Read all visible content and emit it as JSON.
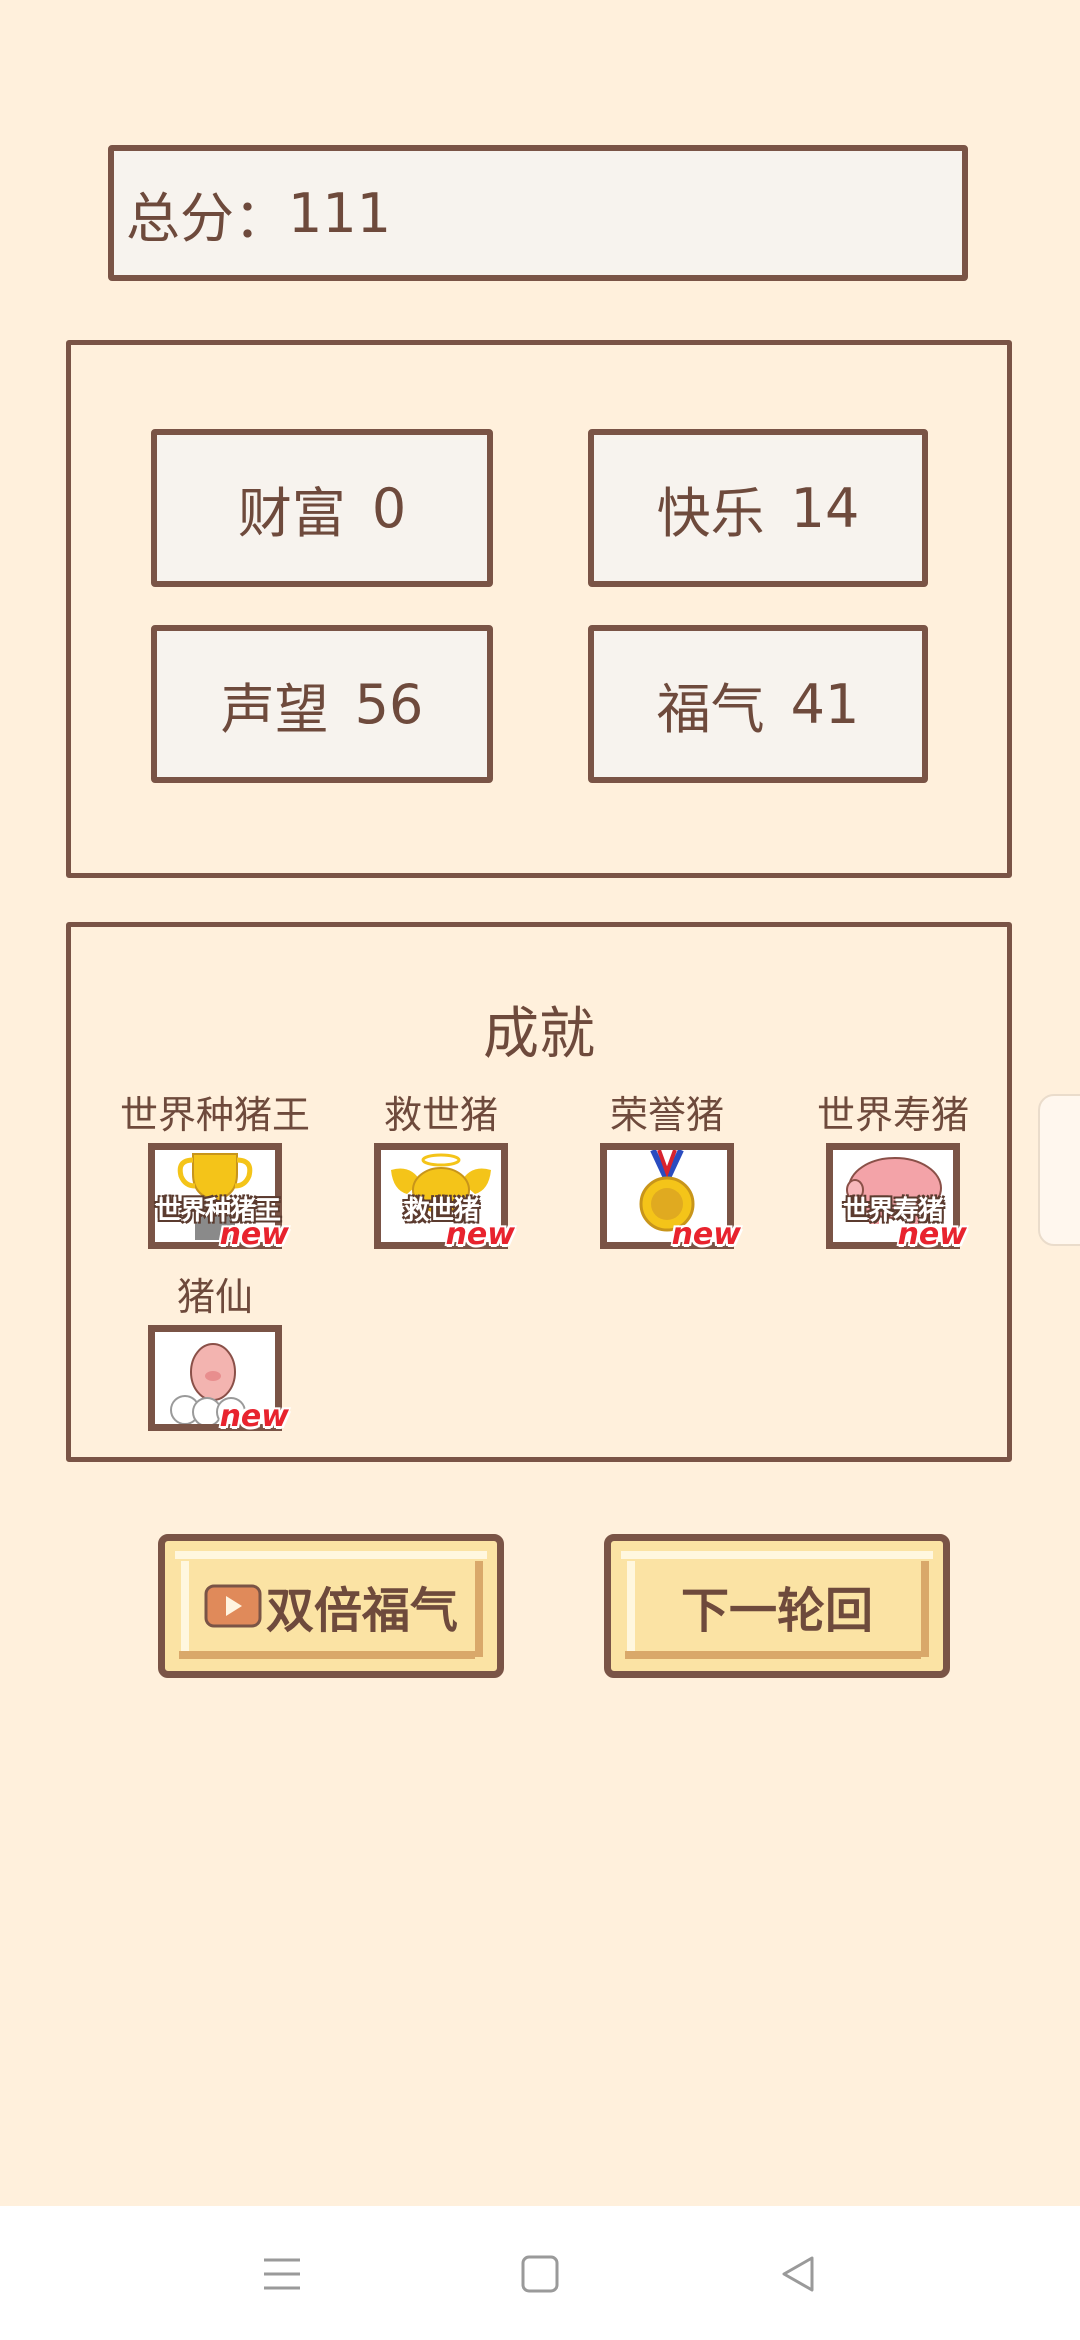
{
  "score": {
    "label": "总分：",
    "value": "111"
  },
  "stats": [
    {
      "name": "财富",
      "value": "0"
    },
    {
      "name": "快乐",
      "value": "14"
    },
    {
      "name": "声望",
      "value": "56"
    },
    {
      "name": "福气",
      "value": "41"
    }
  ],
  "achievements": {
    "title": "成就",
    "items": [
      {
        "label": "世界种猪王",
        "badge_text": "世界种猪王",
        "new": "new",
        "icon": "trophy-icon"
      },
      {
        "label": "救世猪",
        "badge_text": "救世猪",
        "new": "new",
        "icon": "angel-pig-icon"
      },
      {
        "label": "荣誉猪",
        "badge_text": "",
        "new": "new",
        "icon": "medal-icon"
      },
      {
        "label": "世界寿猪",
        "badge_text": "世界寿猪",
        "new": "new",
        "icon": "pink-pig-icon"
      },
      {
        "label": "猪仙",
        "badge_text": "",
        "new": "new",
        "icon": "cloud-pig-icon"
      }
    ]
  },
  "buttons": {
    "double_blessing": "双倍福气",
    "next_round": "下一轮回"
  },
  "colors": {
    "background": "#fff0dc",
    "border": "#7a5446",
    "button_fill": "#fbe3a4",
    "new_tag": "#e8232e"
  }
}
